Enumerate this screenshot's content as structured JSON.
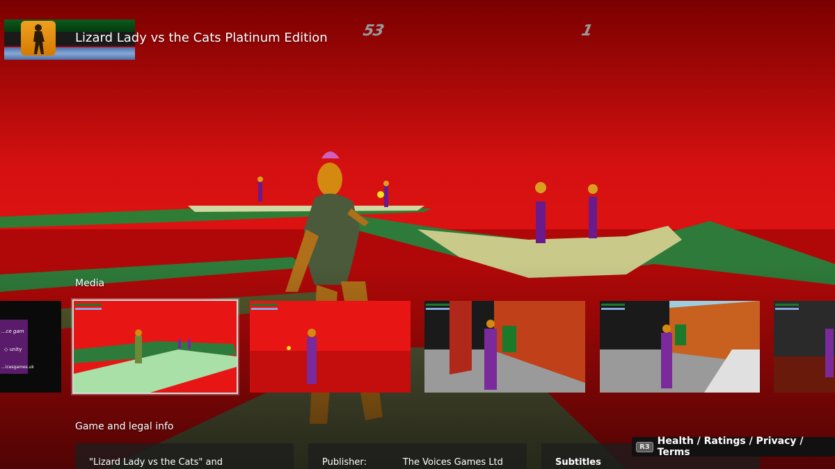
{
  "header": {
    "game_title": "Lizard Lady vs the Cats Platinum Edition",
    "hud_score": "53",
    "hud_lives": "1"
  },
  "media": {
    "heading": "Media",
    "promo_tile": {
      "line1": "...ce gam",
      "unity_label": "unity",
      "url_fragment": "...icesgames.uk"
    },
    "tiles": [
      {
        "id": "promo",
        "selected": false
      },
      {
        "id": "screenshot-1",
        "selected": true
      },
      {
        "id": "screenshot-2",
        "selected": false
      },
      {
        "id": "screenshot-3",
        "selected": false
      },
      {
        "id": "screenshot-4",
        "selected": false
      },
      {
        "id": "screenshot-5",
        "selected": false
      }
    ]
  },
  "legal": {
    "heading": "Game and legal info",
    "card1_text": "\"Lizard Lady vs the Cats\" and",
    "publisher_label": "Publisher:",
    "publisher_value": "The Voices Games Ltd",
    "card3_text": "Subtitles"
  },
  "footer": {
    "button_badge": "R3",
    "hint_text": "Health / Ratings / Privacy / Terms"
  },
  "colors": {
    "sky_red": "#e01010",
    "walkway_green": "#2e7d32",
    "selection_outline": "#d9d9d9"
  }
}
